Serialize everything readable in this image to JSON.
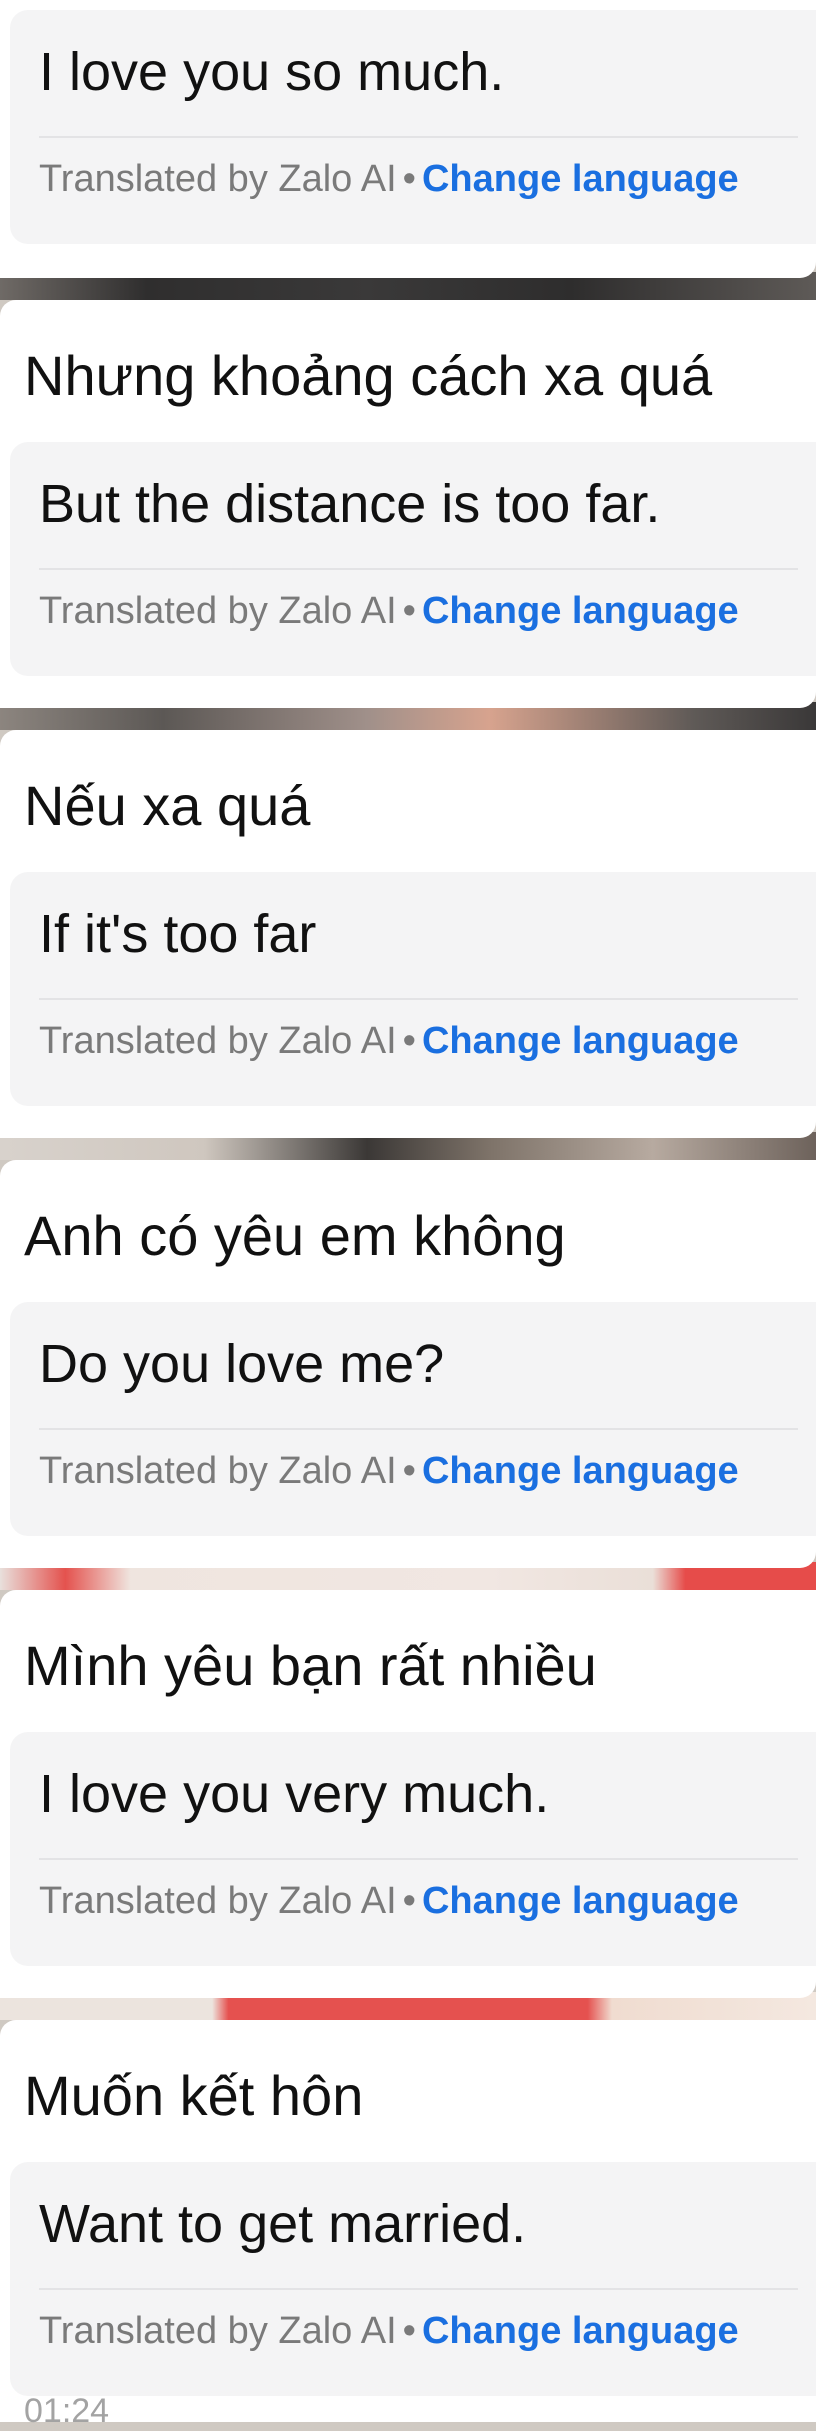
{
  "messages": [
    {
      "original": "",
      "translation": "I love you so much.",
      "translated_by": "Translated by Zalo AI",
      "separator": "•",
      "change_language": "Change language"
    },
    {
      "original": "Nhưng khoảng cách xa quá",
      "translation": "But the distance is too far.",
      "translated_by": "Translated by Zalo AI",
      "separator": "•",
      "change_language": "Change language"
    },
    {
      "original": "Nếu xa quá",
      "translation": "If it's too far",
      "translated_by": "Translated by Zalo AI",
      "separator": "•",
      "change_language": "Change language"
    },
    {
      "original": "Anh có yêu em không",
      "translation": "Do you love me?",
      "translated_by": "Translated by Zalo AI",
      "separator": "•",
      "change_language": "Change language"
    },
    {
      "original": "Mình yêu bạn rất nhiều",
      "translation": "I love you very much.",
      "translated_by": "Translated by Zalo AI",
      "separator": "•",
      "change_language": "Change language"
    },
    {
      "original": "Muốn kết hôn",
      "translation": "Want to get married.",
      "translated_by": "Translated by Zalo AI",
      "separator": "•",
      "change_language": "Change language"
    }
  ],
  "timestamp": "01:24",
  "colors": {
    "link": "#1a6fe0",
    "footer_text": "#7a7a7a",
    "translation_bg": "#f4f4f5",
    "card_bg": "#ffffff"
  }
}
